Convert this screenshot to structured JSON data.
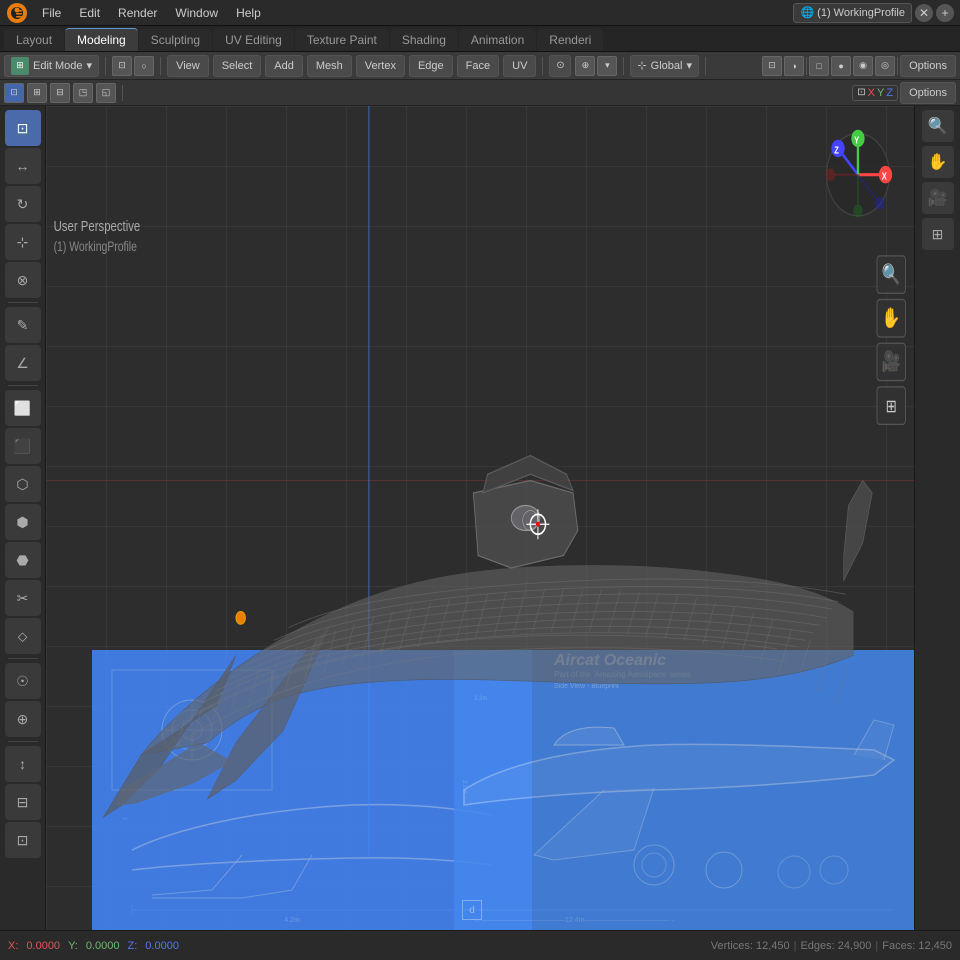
{
  "topMenu": {
    "items": [
      "File",
      "Edit",
      "Render",
      "Window",
      "Help"
    ]
  },
  "workspaceTabs": {
    "tabs": [
      "Layout",
      "Modeling",
      "Sculpting",
      "UV Editing",
      "Texture Paint",
      "Shading",
      "Animation",
      "Renderi"
    ],
    "active": "Modeling"
  },
  "toolbar": {
    "modeLabel": "Edit Mode",
    "viewLabel": "View",
    "selectLabel": "Select",
    "addLabel": "Add",
    "meshLabel": "Mesh",
    "vertexLabel": "Vertex",
    "edgeLabel": "Edge",
    "faceLabel": "Face",
    "uvLabel": "UV",
    "globalLabel": "Global",
    "optionsLabel": "Options"
  },
  "header": {
    "xLabel": "X",
    "yLabel": "Y",
    "zLabel": "Z"
  },
  "viewport": {
    "perspLabel": "User Perspective",
    "sceneLabel": "(1) WorkingProfile"
  },
  "gizmo": {
    "xLabel": "X",
    "yLabel": "Y",
    "zLabel": "Z"
  },
  "coordsBar": {
    "xVal": "0.0000",
    "yVal": "0.0000",
    "zVal": "0.0000"
  },
  "blueprint": {
    "title": "Aircat Oceanic",
    "subtitle": "Part of the 'Amazing Aerospace' series",
    "label": "Side View - Blueprint"
  },
  "leftTools": [
    "⊹",
    "↔",
    "↻",
    "⊡",
    "⊗",
    "◎",
    "✎",
    "∠",
    "⬜",
    "⬛",
    "⬡",
    "⬢",
    "⬣",
    "✂",
    "⬦",
    "☉",
    "⊕",
    "⊞",
    "↕",
    "⊟"
  ],
  "rightTools": [
    "🔍",
    "✋",
    "🎥",
    "⊞"
  ]
}
